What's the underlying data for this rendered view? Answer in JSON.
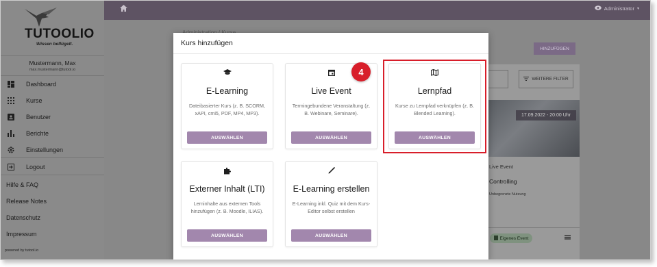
{
  "app": {
    "brand": "TUTOOLIO",
    "tagline": "Wissen beflügelt.",
    "user_name": "Mustermann, Max",
    "user_email": "max.mustermann@tutool.io",
    "admin_label": "Administrator",
    "powered_by": "powered by tutool.io"
  },
  "sidebar": {
    "items": [
      {
        "label": "Dashboard",
        "icon": "dashboard-icon"
      },
      {
        "label": "Kurse",
        "icon": "grid-icon"
      },
      {
        "label": "Benutzer",
        "icon": "user-card-icon"
      },
      {
        "label": "Berichte",
        "icon": "bar-chart-icon"
      },
      {
        "label": "Einstellungen",
        "icon": "gear-icon"
      },
      {
        "label": "Logout",
        "icon": "logout-icon"
      }
    ],
    "links": [
      "Hilfe & FAQ",
      "Release Notes",
      "Datenschutz",
      "Impressum"
    ]
  },
  "background": {
    "breadcrumb": "Administration / Kurse",
    "add_button": "HINZUFÜGEN",
    "filter_button": "WEITERE FILTER",
    "date_overlay": "17.09.2022 - 20:00 Uhr",
    "course_type": "Live Event",
    "course_title": "Controlling",
    "usage": "Unbegrenzte Nutzung",
    "badge": "Eigenes Event"
  },
  "modal": {
    "title": "Kurs hinzufügen",
    "cards": [
      {
        "title": "E-Learning",
        "description": "Dateibasierter Kurs (z. B. SCORM, xAPI, cmi5, PDF, MP4, MP3).",
        "button": "AUSWÄHLEN",
        "icon": "graduation-cap-icon"
      },
      {
        "title": "Live Event",
        "description": "Termingebundene Veranstaltung (z. B. Webinare, Seminare).",
        "button": "AUSWÄHLEN",
        "icon": "calendar-icon"
      },
      {
        "title": "Lernpfad",
        "description": "Kurse zu Lernpfad verknüpfen (z. B. Blended Learning).",
        "button": "AUSWÄHLEN",
        "icon": "map-icon"
      },
      {
        "title": "Externer Inhalt (LTI)",
        "description": "Lerninhalte aus externen Tools hinzufügen (z. B. Moodle, ILIAS).",
        "button": "AUSWÄHLEN",
        "icon": "puzzle-icon"
      },
      {
        "title": "E-Learning erstellen",
        "description": "E-Learning inkl. Quiz mit dem Kurs-Editor selbst erstellen",
        "button": "AUSWÄHLEN",
        "icon": "brush-icon"
      }
    ]
  },
  "annotation": {
    "step": "4",
    "highlight_color": "#d81e2a"
  },
  "colors": {
    "accent_button": "#a287ad",
    "topbar": "#5e5363"
  }
}
